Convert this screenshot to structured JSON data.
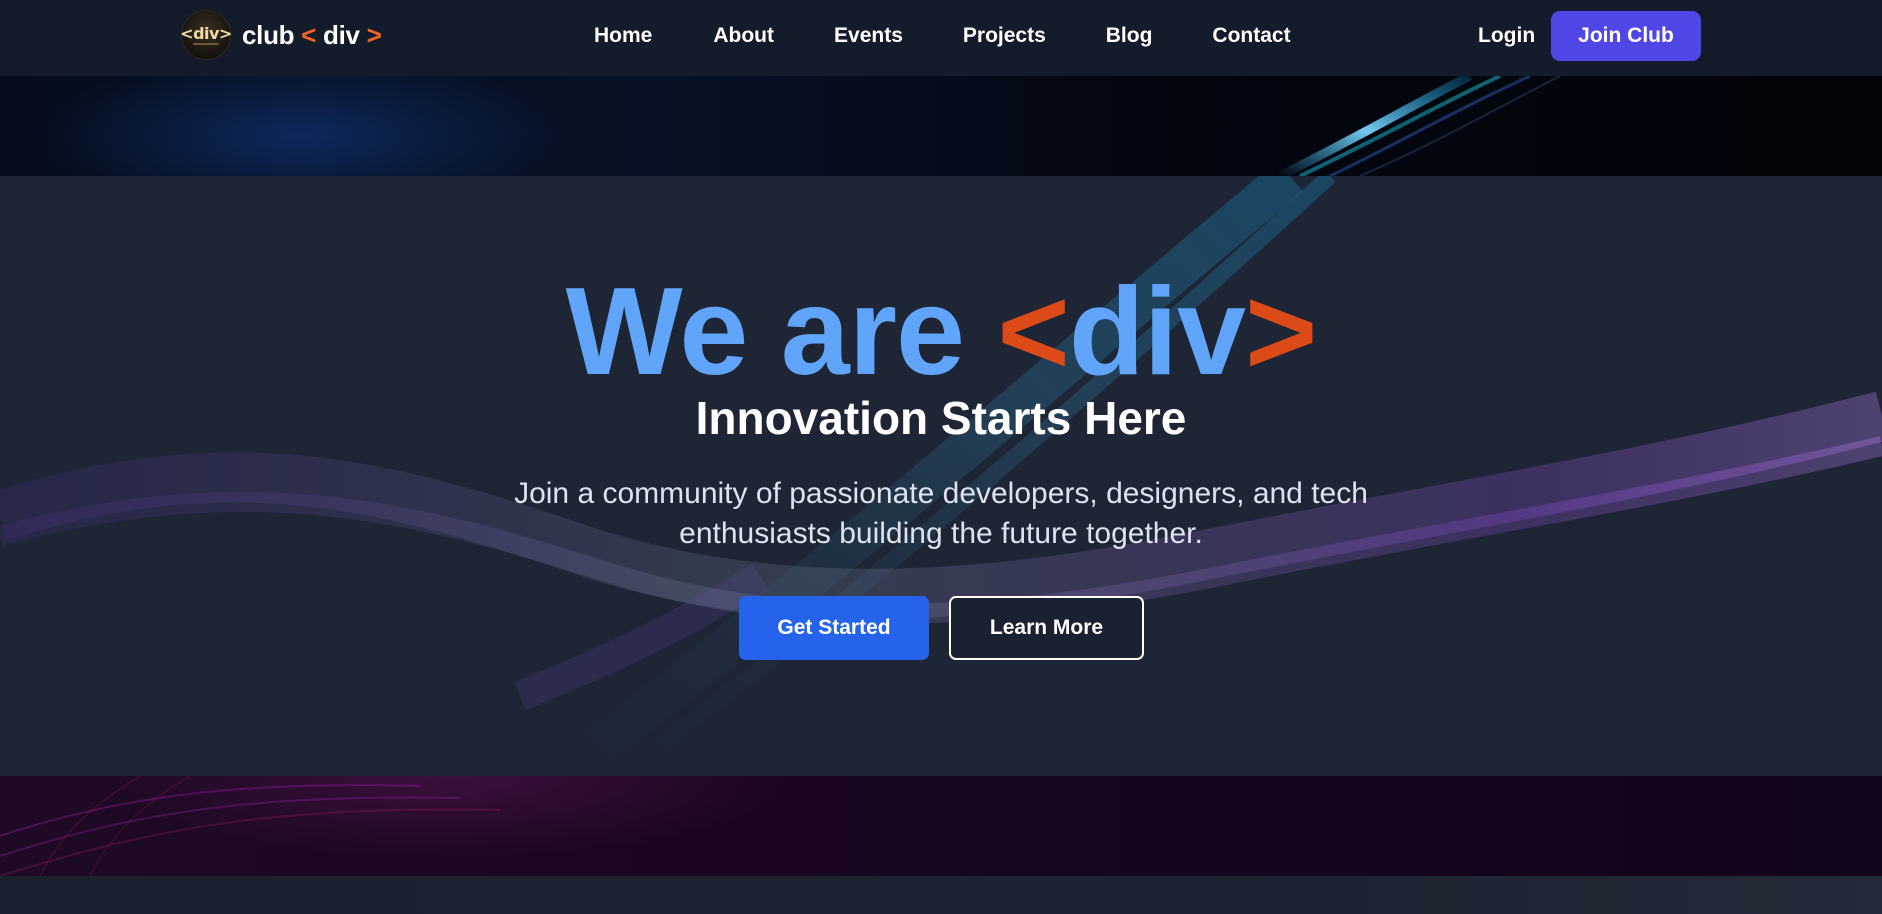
{
  "nav": {
    "logo_badge": "<div>",
    "logo_text_prefix": "club ",
    "logo_text_lt": "<",
    "logo_text_mid": " div ",
    "logo_text_gt": ">",
    "links": [
      "Home",
      "About",
      "Events",
      "Projects",
      "Blog",
      "Contact"
    ],
    "login_label": "Login",
    "join_label": "Join Club"
  },
  "hero": {
    "title_prefix": "We are ",
    "title_lt": "<",
    "title_mid": "div",
    "title_gt": ">",
    "subtitle": "Innovation Starts Here",
    "description": "Join a community of passionate developers, designers, and tech enthusiasts building the future together.",
    "primary_cta": "Get Started",
    "secondary_cta": "Learn More"
  },
  "colors": {
    "nav_bg": "#141b2b",
    "brand_orange": "#f26522",
    "title_blue": "#60a5fa",
    "title_orange": "#dc4a17",
    "join_button": "#4f46e5",
    "primary_button": "#2563eb"
  }
}
